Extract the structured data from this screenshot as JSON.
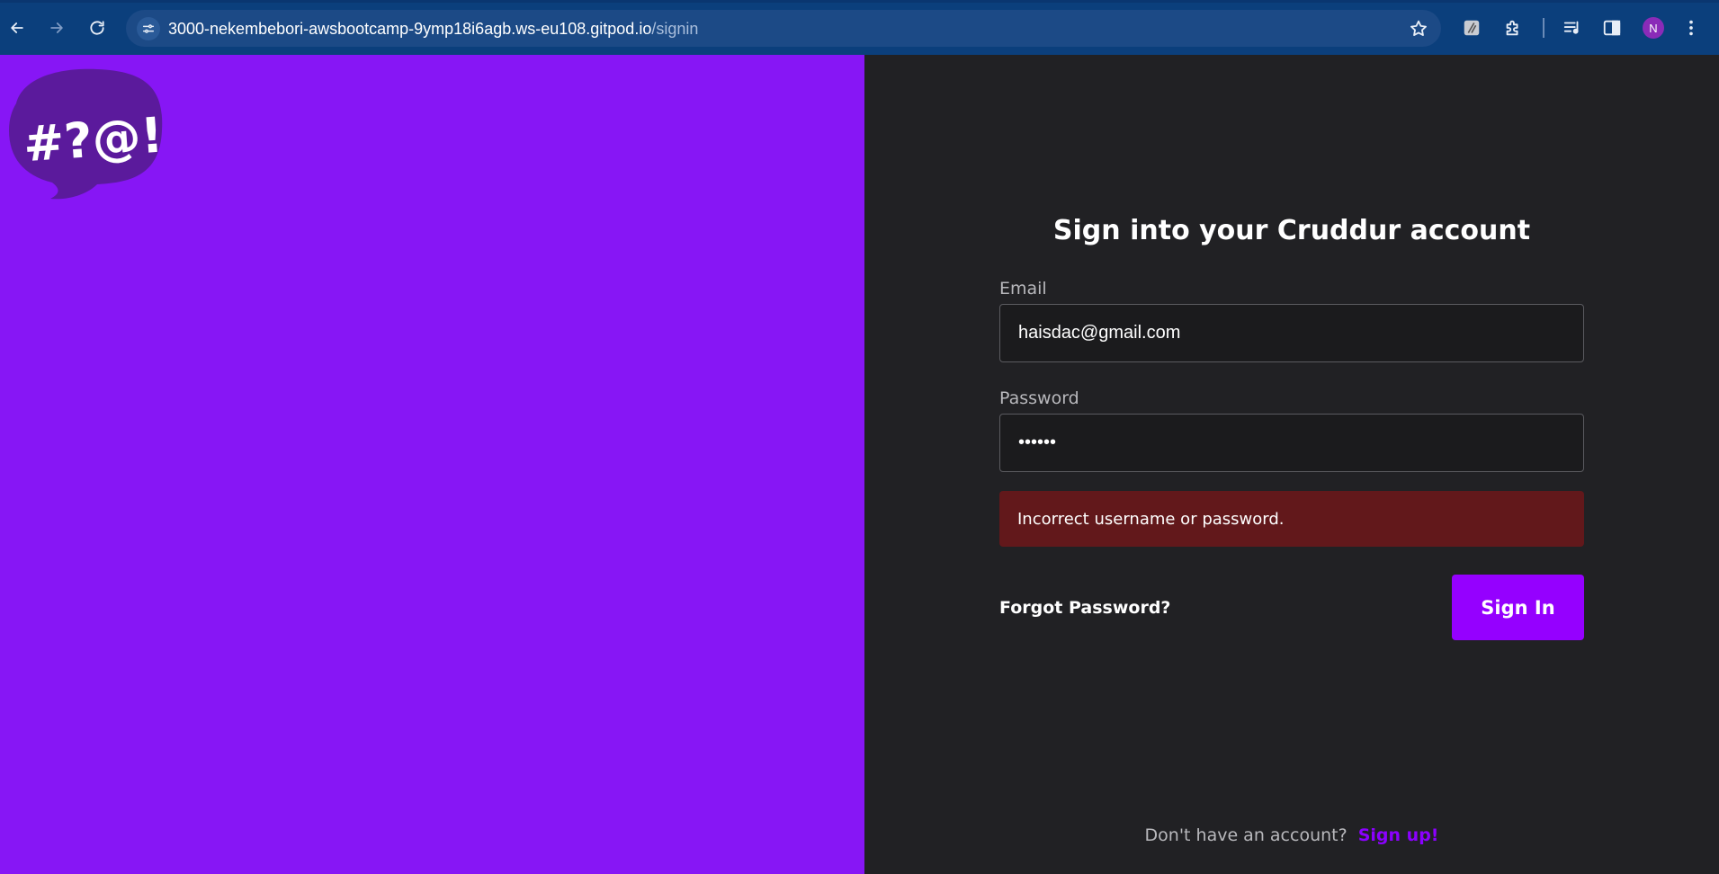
{
  "browser": {
    "url_host": "3000-nekembebori-awsbootcamp-9ymp18i6agb.ws-eu108.gitpod.io",
    "url_path": "/signin",
    "back_icon": "arrow-left-icon",
    "forward_icon": "arrow-right-icon",
    "reload_icon": "reload-icon",
    "site_info_icon": "tune-icon",
    "bookmark_icon": "star-icon",
    "extensions": [
      "extension-app-icon",
      "puzzle-icon",
      "media-queue-icon",
      "side-panel-icon"
    ],
    "avatar_initial": "N",
    "menu_icon": "kebab-menu-icon"
  },
  "logo": {
    "text": "#?@!",
    "bubble_color": "#5b1a9c"
  },
  "form": {
    "title": "Sign into your Cruddur account",
    "email_label": "Email",
    "email_value": "haisdac@gmail.com",
    "password_label": "Password",
    "password_value": "••••••",
    "error_message": "Incorrect username or password.",
    "forgot_label": "Forgot Password?",
    "submit_label": "Sign In"
  },
  "footer": {
    "prompt": "Don't have an account?",
    "signup_label": "Sign up!"
  },
  "colors": {
    "brand_purple": "#8716f5",
    "button_purple": "#9500ff",
    "error_bg": "#62181b",
    "dark_bg": "#212124"
  }
}
